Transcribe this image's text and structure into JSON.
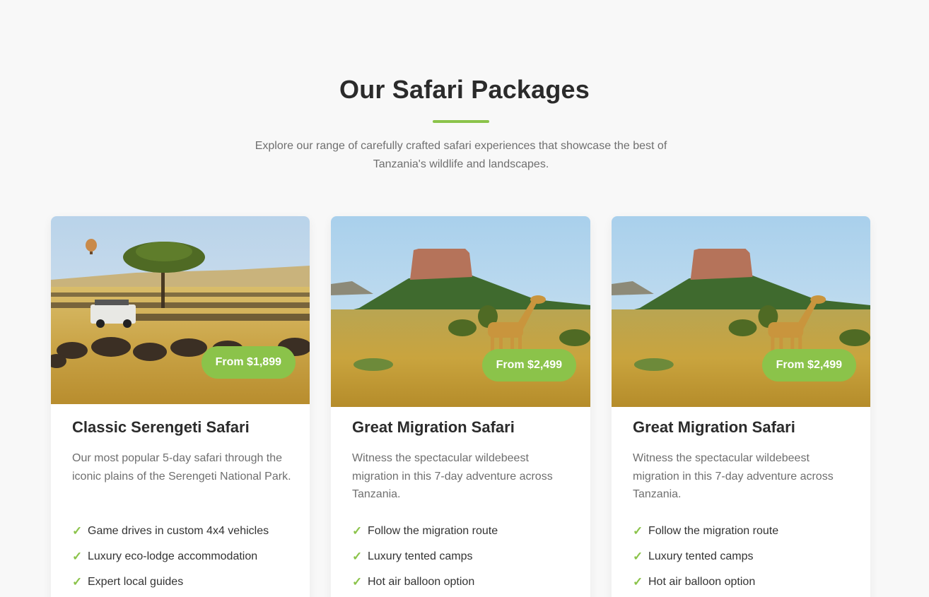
{
  "section": {
    "title": "Our Safari Packages",
    "subtitle": "Explore our range of carefully crafted safari experiences that showcase the best of Tanzania's wildlife and landscapes."
  },
  "accent_color": "#8bc34a",
  "packages": [
    {
      "price": "From $1,899",
      "title": "Classic Serengeti Safari",
      "description": "Our most popular 5-day safari through the iconic plains of the Serengeti National Park.",
      "features": [
        "Game drives in custom 4x4 vehicles",
        "Luxury eco-lodge accommodation",
        "Expert local guides"
      ],
      "image": "serengeti-wildebeest-photo"
    },
    {
      "price": "From $2,499",
      "title": "Great Migration Safari",
      "description": "Witness the spectacular wildebeest migration in this 7-day adventure across Tanzania.",
      "features": [
        "Follow the migration route",
        "Luxury tented camps",
        "Hot air balloon option"
      ],
      "image": "giraffe-mesa-photo"
    },
    {
      "price": "From $2,499",
      "title": "Great Migration Safari",
      "description": "Witness the spectacular wildebeest migration in this 7-day adventure across Tanzania.",
      "features": [
        "Follow the migration route",
        "Luxury tented camps",
        "Hot air balloon option"
      ],
      "image": "giraffe-mesa-photo"
    }
  ],
  "icons": {
    "feature_check": "check-icon",
    "check_glyph": "✓"
  }
}
